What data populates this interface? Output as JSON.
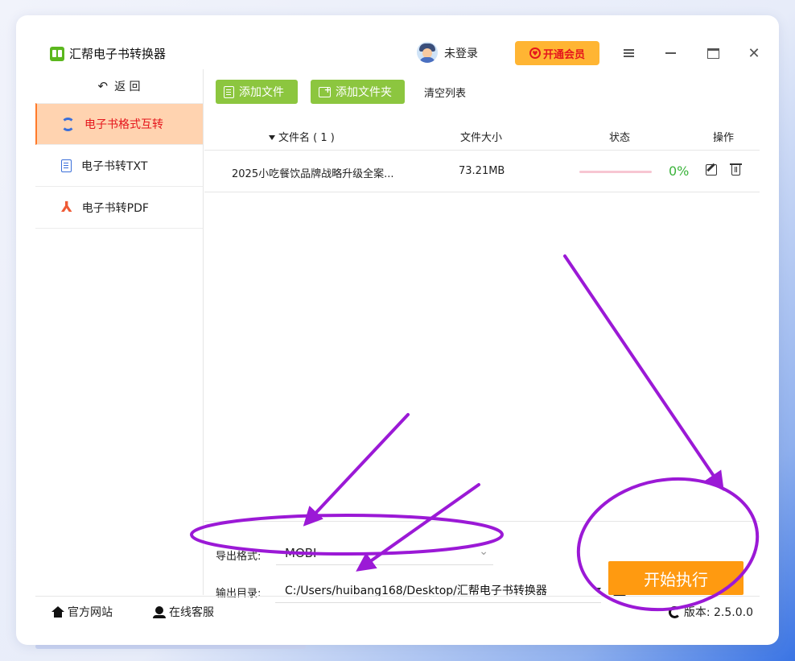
{
  "app": {
    "title": "汇帮电子书转换器",
    "login_text": "未登录",
    "vip_label": "开通会员"
  },
  "sidebar": {
    "back_label": "返  回",
    "items": [
      {
        "label": "电子书格式互转",
        "icon": "refresh-icon",
        "active": true
      },
      {
        "label": "电子书转TXT",
        "icon": "document-icon",
        "active": false
      },
      {
        "label": "电子书转PDF",
        "icon": "pdf-icon",
        "active": false
      }
    ]
  },
  "toolbar": {
    "add_file": "添加文件",
    "add_folder": "添加文件夹",
    "clear_list": "清空列表"
  },
  "table": {
    "columns": {
      "name": "文件名 ( 1 )",
      "size": "文件大小",
      "status": "状态",
      "ops": "操作"
    },
    "rows": [
      {
        "name": "2025小吃餐饮品牌战略升级全案...",
        "size": "73.21MB",
        "progress": 0,
        "percent": "0%"
      }
    ]
  },
  "output": {
    "format_label": "导出格式:",
    "format_value": "MOBI",
    "dir_label": "输出目录:",
    "dir_value": "C:/Users/huibang168/Desktop/汇帮电子书转换器",
    "start_label": "开始执行"
  },
  "footer": {
    "site": "官方网站",
    "service": "在线客服",
    "version": "版本: 2.5.0.0"
  },
  "colors": {
    "accent_green": "#8cc63f",
    "accent_orange": "#ff9a10",
    "active_red": "#e5161c",
    "active_bg": "#ffd3b0",
    "annotation": "#9b19d6"
  }
}
